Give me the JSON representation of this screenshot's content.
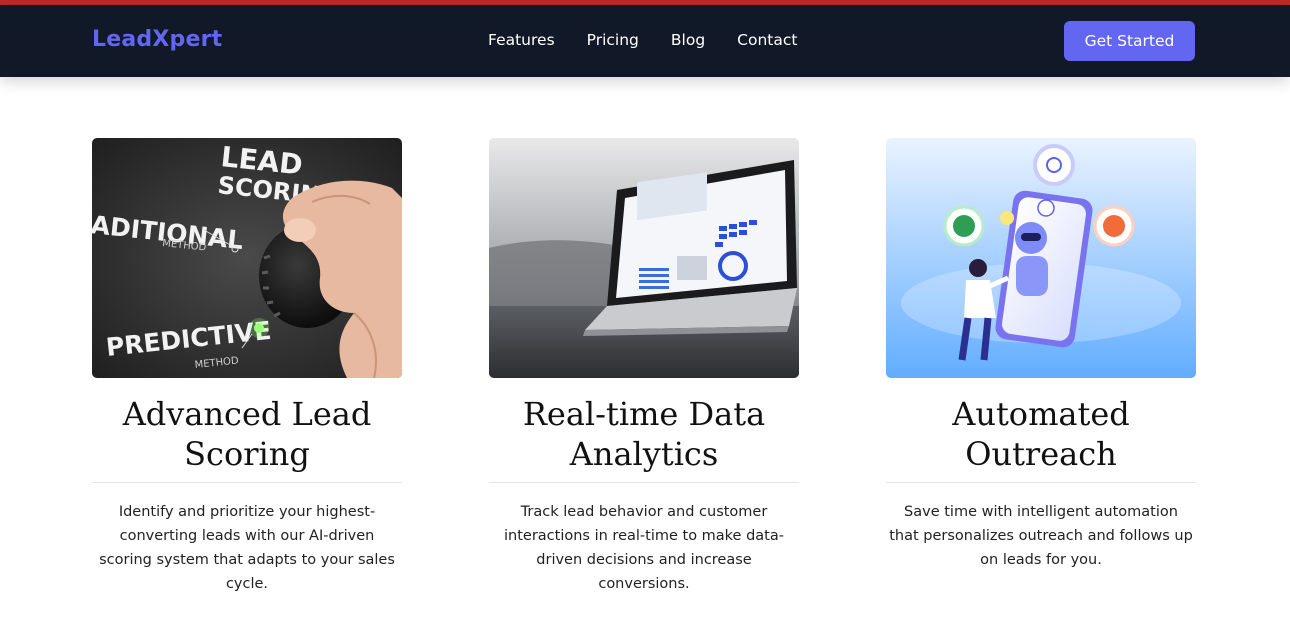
{
  "navbar": {
    "brand": "LeadXpert",
    "links": [
      "Features",
      "Pricing",
      "Blog",
      "Contact"
    ],
    "cta_label": "Get Started"
  },
  "features": [
    {
      "title": "Advanced Lead Scoring",
      "description": "Identify and prioritize your highest-converting leads with our AI-driven scoring system that adapts to your sales cycle.",
      "image_text": {
        "top": "LEAD",
        "top2": "SCORING",
        "left": "ADITIONAL",
        "left_sub": "METHOD",
        "bottom": "PREDICTIVE",
        "bottom_sub": "METHOD"
      }
    },
    {
      "title": "Real-time Data Analytics",
      "description": "Track lead behavior and customer interactions in real-time to make data-driven decisions and increase conversions."
    },
    {
      "title": "Automated Outreach",
      "description": "Save time with intelligent automation that personalizes outreach and follows up on leads for you."
    }
  ],
  "colors": {
    "navbar_bg": "#111827",
    "accent": "#6366f1",
    "top_stripe": "#c0282d"
  }
}
